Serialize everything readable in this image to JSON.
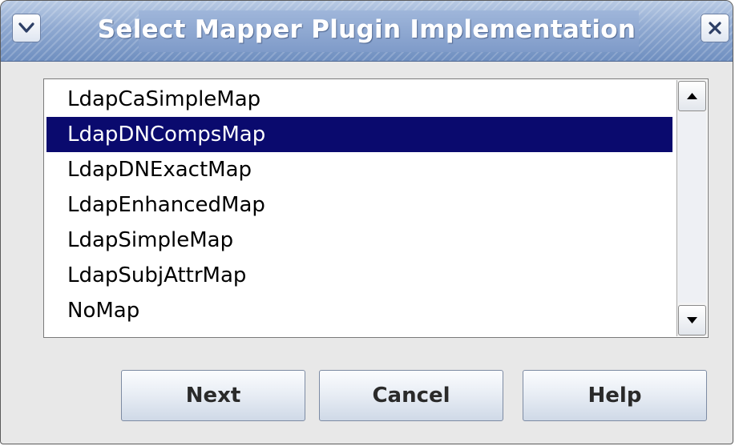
{
  "window": {
    "title": "Select Mapper Plugin Implementation",
    "menu_icon": "chevron-down-icon",
    "close_icon": "close-icon"
  },
  "list": {
    "items": [
      {
        "label": "LdapCaSimpleMap",
        "selected": false
      },
      {
        "label": "LdapDNCompsMap",
        "selected": true
      },
      {
        "label": "LdapDNExactMap",
        "selected": false
      },
      {
        "label": "LdapEnhancedMap",
        "selected": false
      },
      {
        "label": "LdapSimpleMap",
        "selected": false
      },
      {
        "label": "LdapSubjAttrMap",
        "selected": false
      },
      {
        "label": "NoMap",
        "selected": false
      }
    ],
    "selection_color": "#0a0a6e"
  },
  "scrollbar": {
    "up_icon": "arrow-up-icon",
    "down_icon": "arrow-down-icon"
  },
  "buttons": {
    "next_label": "Next",
    "cancel_label": "Cancel",
    "help_label": "Help"
  }
}
